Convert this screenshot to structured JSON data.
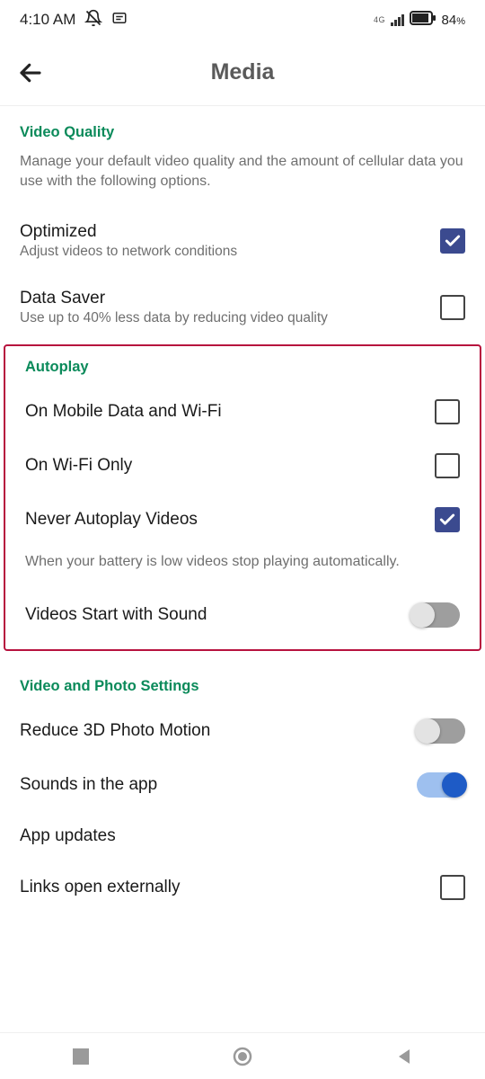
{
  "status": {
    "time": "4:10 AM",
    "network_label": "4G",
    "battery_percent": "84",
    "battery_sym": "%"
  },
  "header": {
    "title": "Media"
  },
  "video_quality": {
    "header": "Video Quality",
    "desc": "Manage your default video quality and the amount of cellular data you use with the following options.",
    "optimized_title": "Optimized",
    "optimized_sub": "Adjust videos to network conditions",
    "optimized_checked": true,
    "data_saver_title": "Data Saver",
    "data_saver_sub": "Use up to 40% less data by reducing video quality",
    "data_saver_checked": false
  },
  "autoplay": {
    "header": "Autoplay",
    "mobile_wifi": "On Mobile Data and Wi-Fi",
    "mobile_wifi_checked": false,
    "wifi_only": "On Wi-Fi Only",
    "wifi_only_checked": false,
    "never": "Never Autoplay Videos",
    "never_checked": true,
    "battery_note": "When your battery is low videos stop playing automatically.",
    "sound_title": "Videos Start with Sound",
    "sound_on": false
  },
  "video_photo": {
    "header": "Video and Photo Settings",
    "reduce_3d": "Reduce 3D Photo Motion",
    "reduce_3d_on": false,
    "sounds_app": "Sounds in the app",
    "sounds_app_on": true,
    "app_updates": "App updates",
    "links_external": "Links open externally",
    "links_external_checked": false
  }
}
